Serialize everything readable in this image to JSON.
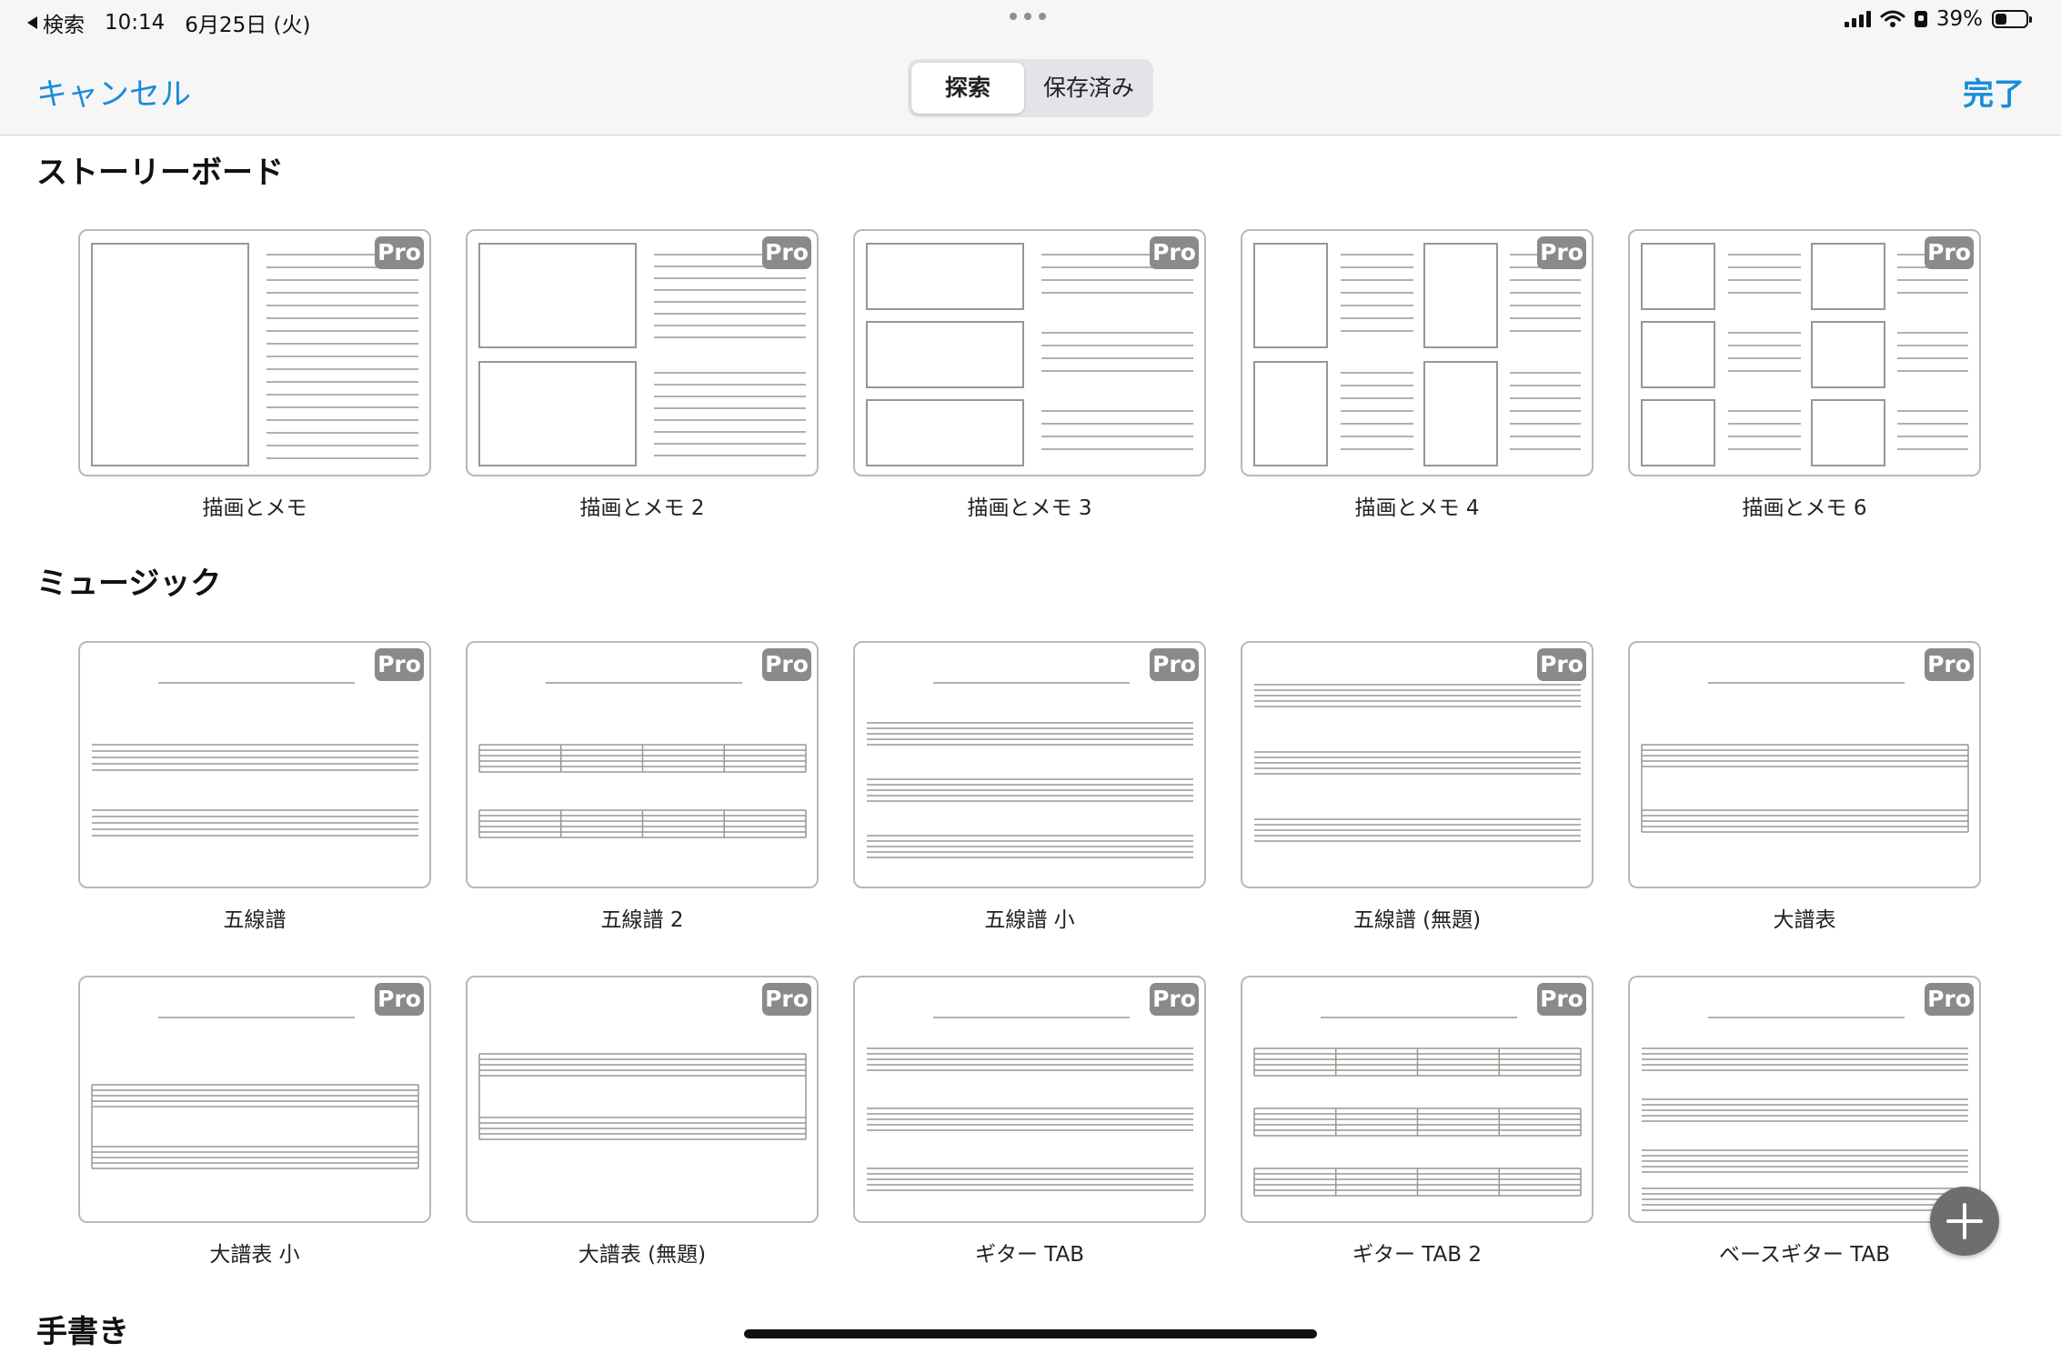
{
  "status_bar": {
    "back_label": "検索",
    "time": "10:14",
    "date": "6月25日 (火)",
    "battery_percent": "39%",
    "battery_level": 0.39
  },
  "nav": {
    "cancel": "キャンセル",
    "done": "完了",
    "segments": [
      "探索",
      "保存済み"
    ],
    "selected_segment": "探索"
  },
  "sections": [
    {
      "title": "ストーリーボード",
      "templates": [
        {
          "name": "描画とメモ",
          "badge": "Pro"
        },
        {
          "name": "描画とメモ 2",
          "badge": "Pro"
        },
        {
          "name": "描画とメモ 3",
          "badge": "Pro"
        },
        {
          "name": "描画とメモ 4",
          "badge": "Pro"
        },
        {
          "name": "描画とメモ 6",
          "badge": "Pro"
        }
      ]
    },
    {
      "title": "ミュージック",
      "templates": [
        {
          "name": "五線譜",
          "badge": "Pro"
        },
        {
          "name": "五線譜 2",
          "badge": "Pro"
        },
        {
          "name": "五線譜 小",
          "badge": "Pro"
        },
        {
          "name": "五線譜 (無題)",
          "badge": "Pro"
        },
        {
          "name": "大譜表",
          "badge": "Pro"
        },
        {
          "name": "大譜表 小",
          "badge": "Pro"
        },
        {
          "name": "大譜表 (無題)",
          "badge": "Pro"
        },
        {
          "name": "ギター TAB",
          "badge": "Pro"
        },
        {
          "name": "ギター TAB 2",
          "badge": "Pro"
        },
        {
          "name": "ベースギター TAB",
          "badge": "Pro"
        }
      ]
    },
    {
      "title": "手書き",
      "templates": []
    }
  ],
  "icons": {
    "back": "triangle-left-icon",
    "signal": "cellular-signal-icon",
    "wifi": "wifi-icon",
    "orientation_lock": "orientation-lock-icon",
    "battery": "battery-icon",
    "more": "more-dots-icon",
    "add": "plus-icon"
  }
}
